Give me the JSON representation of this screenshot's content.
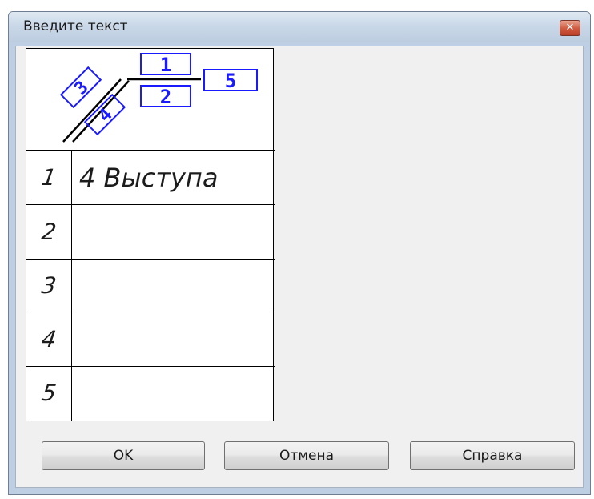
{
  "window": {
    "title": "Введите текст",
    "close_glyph": "✕"
  },
  "diagram": {
    "box1": "1",
    "box2": "2",
    "box3": "3",
    "box4": "4",
    "box5": "5"
  },
  "rows": [
    {
      "num": "1",
      "text": "4 Выступа"
    },
    {
      "num": "2",
      "text": ""
    },
    {
      "num": "3",
      "text": ""
    },
    {
      "num": "4",
      "text": ""
    },
    {
      "num": "5",
      "text": ""
    }
  ],
  "buttons": {
    "ok": "OK",
    "cancel": "Отмена",
    "help": "Справка"
  },
  "colors": {
    "diagram_blue": "#1a1aff"
  }
}
